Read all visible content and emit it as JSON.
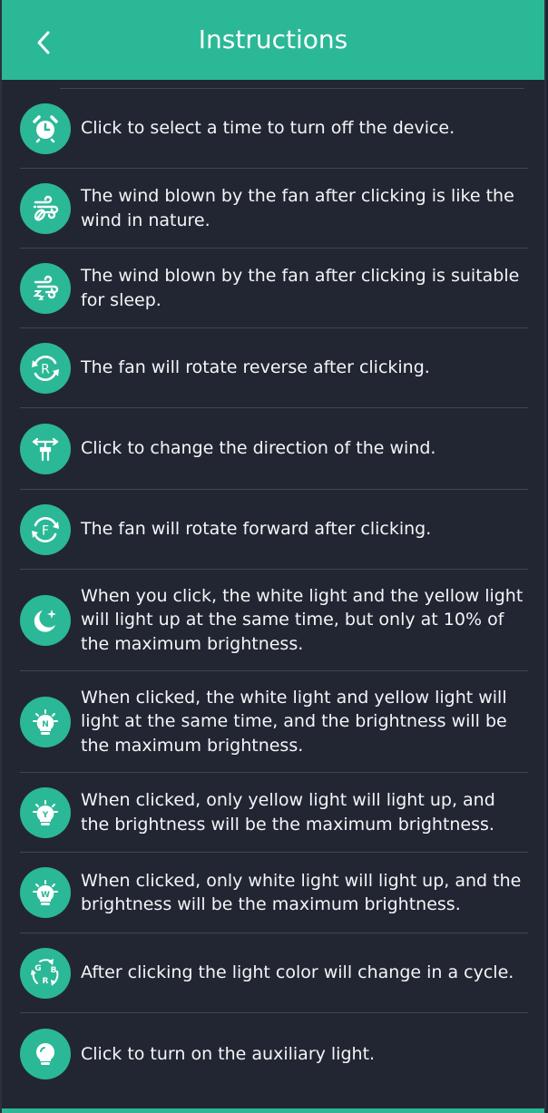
{
  "header": {
    "title": "Instructions",
    "back_icon": "chevron-left-icon"
  },
  "colors": {
    "accent": "#2bb896",
    "background": "#222633",
    "divider": "#3f4555",
    "text": "#f4f5f7"
  },
  "items": [
    {
      "icon": "alarm-clock-icon",
      "text": "Click to select a time to turn off the device."
    },
    {
      "icon": "natural-wind-icon",
      "text": "The wind blown by the fan after clicking is like the wind in nature."
    },
    {
      "icon": "sleep-wind-icon",
      "text": "The wind blown by the fan after clicking is suitable for sleep."
    },
    {
      "icon": "reverse-rotation-icon",
      "text": "The fan will rotate reverse after clicking."
    },
    {
      "icon": "wind-direction-icon",
      "text": "Click to change the direction of the wind."
    },
    {
      "icon": "forward-rotation-icon",
      "text": "The fan will rotate forward after clicking."
    },
    {
      "icon": "night-light-icon",
      "text": "When you click, the white light and the yellow light will light up at the same time, but only at 10% of the maximum brightness."
    },
    {
      "icon": "neutral-light-icon",
      "text": "When clicked, the white light and yellow light will light at the same time, and the brightness will be the maximum brightness."
    },
    {
      "icon": "yellow-light-icon",
      "text": "When clicked, only yellow light will light up, and the brightness will be the maximum brightness."
    },
    {
      "icon": "white-light-icon",
      "text": "When clicked, only white light will light up, and the brightness will be the maximum brightness."
    },
    {
      "icon": "rgb-cycle-icon",
      "text": "After clicking the light color will change in a cycle."
    },
    {
      "icon": "auxiliary-light-icon",
      "text": "Click to turn on the auxiliary light."
    }
  ],
  "icon_letters": {
    "reverse": "R",
    "forward": "F",
    "neutral": "N",
    "yellow": "Y",
    "white": "W",
    "rgb_g": "G",
    "rgb_b": "B",
    "rgb_r": "R"
  }
}
